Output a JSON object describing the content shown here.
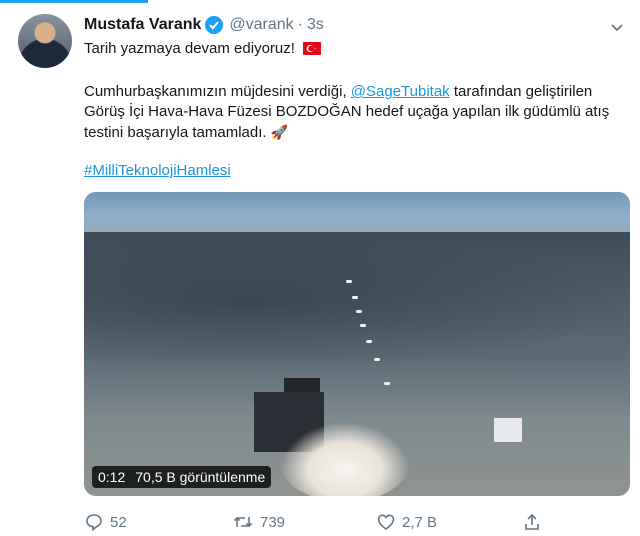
{
  "tweet": {
    "display_name": "Mustafa Varank",
    "handle": "@varank",
    "separator": "·",
    "time": "3s",
    "line1": "Tarih yazmaya devam ediyoruz!",
    "body_part1": "Cumhurbaşkanımızın müjdesini verdiği, ",
    "mention": "@SageTubitak",
    "body_part2": " tarafından geliştirilen Görüş İçi Hava-Hava Füzesi BOZDOĞAN hedef uçağa yapılan ilk güdümlü atış testini başarıyla tamamladı.",
    "hashtag": "#MilliTeknolojiHamlesi"
  },
  "media": {
    "duration": "0:12",
    "views": "70,5 B görüntülenme"
  },
  "actions": {
    "replies": "52",
    "retweets": "739",
    "likes": "2,7 B"
  },
  "colors": {
    "accent": "#1da1f2",
    "link": "#1b95e0",
    "muted": "#657786",
    "flag": "#e30a17"
  },
  "icons": [
    "verified-badge-icon",
    "turkey-flag-icon",
    "rocket-icon",
    "chevron-down-icon",
    "reply-icon",
    "retweet-icon",
    "like-icon",
    "share-icon"
  ]
}
